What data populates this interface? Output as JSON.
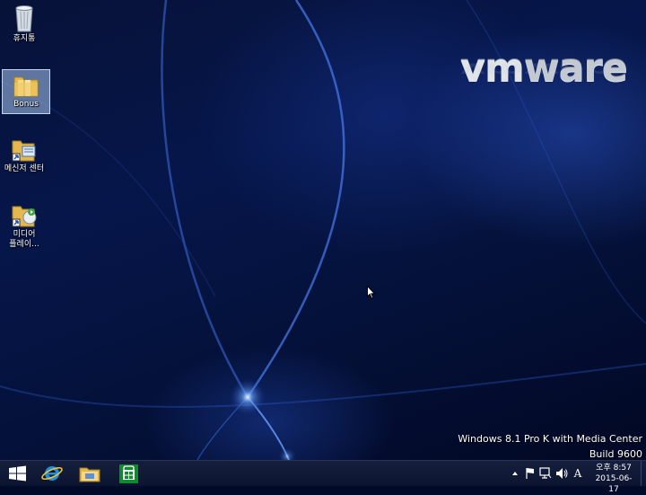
{
  "desktop": {
    "icons": [
      {
        "label": "휴지통",
        "icon": "recycle-bin-icon"
      },
      {
        "label": "Bonus",
        "icon": "folder-icon",
        "selected": true
      },
      {
        "label": "메신저 센터",
        "icon": "messenger-shortcut-icon"
      },
      {
        "label": "미디어 플레이...",
        "label_lines": [
          "미디어",
          "플레이..."
        ],
        "icon": "media-player-shortcut-icon"
      }
    ],
    "logo": {
      "text_vm": "vm",
      "text_ware": "ware"
    },
    "watermark": {
      "line1": "Windows 8.1 Pro K with Media Center",
      "line2": "Build 9600"
    }
  },
  "taskbar": {
    "pinned": [
      {
        "name": "start",
        "icon": "windows-logo-icon"
      },
      {
        "name": "internet-explorer",
        "icon": "ie-icon"
      },
      {
        "name": "file-explorer",
        "icon": "file-explorer-icon"
      },
      {
        "name": "store",
        "icon": "store-icon"
      }
    ],
    "tray": {
      "ime": "A",
      "time": "오후 8:57",
      "date": "2015-06-17"
    }
  },
  "colors": {
    "taskbar": "#0f1834",
    "selection": "#aac8f0",
    "store_green": "#0f8a2c",
    "ie_blue": "#1e8fe1"
  }
}
